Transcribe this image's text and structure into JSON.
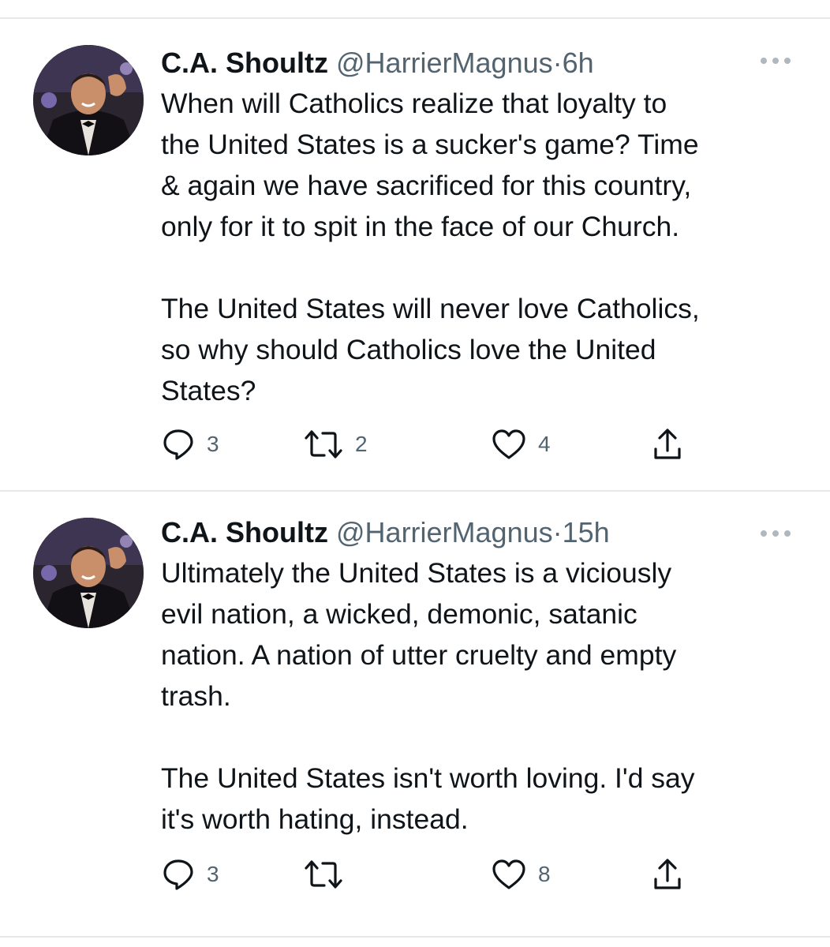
{
  "tweets": [
    {
      "author_name": "C.A. Shoultz",
      "handle": "@HarrierMagnus",
      "separator": "·",
      "time": "6h",
      "paragraphs": [
        "When will Catholics realize that loyalty to\nthe United States is a sucker's game? Time\n& again we have sacrificed for this country,\nonly for it to spit in the face of our Church.",
        "The United States will never love Catholics,\nso why should Catholics love the United\nStates?"
      ],
      "reply_count": "3",
      "retweet_count": "2",
      "like_count": "4"
    },
    {
      "author_name": "C.A. Shoultz",
      "handle": "@HarrierMagnus",
      "separator": "·",
      "time": "15h",
      "paragraphs": [
        "Ultimately the United States is a viciously\nevil nation, a wicked, demonic, satanic\nnation. A nation of utter cruelty and empty\ntrash.",
        "The United States isn't worth loving. I'd say\nit's worth hating, instead."
      ],
      "reply_count": "3",
      "retweet_count": "",
      "like_count": "8"
    }
  ],
  "icons": {
    "reply": "reply-icon",
    "retweet": "retweet-icon",
    "like": "heart-icon",
    "share": "share-icon",
    "more": "more-icon"
  },
  "colors": {
    "text": "#0f1419",
    "secondary": "#536471",
    "divider": "#e6e9ec"
  }
}
